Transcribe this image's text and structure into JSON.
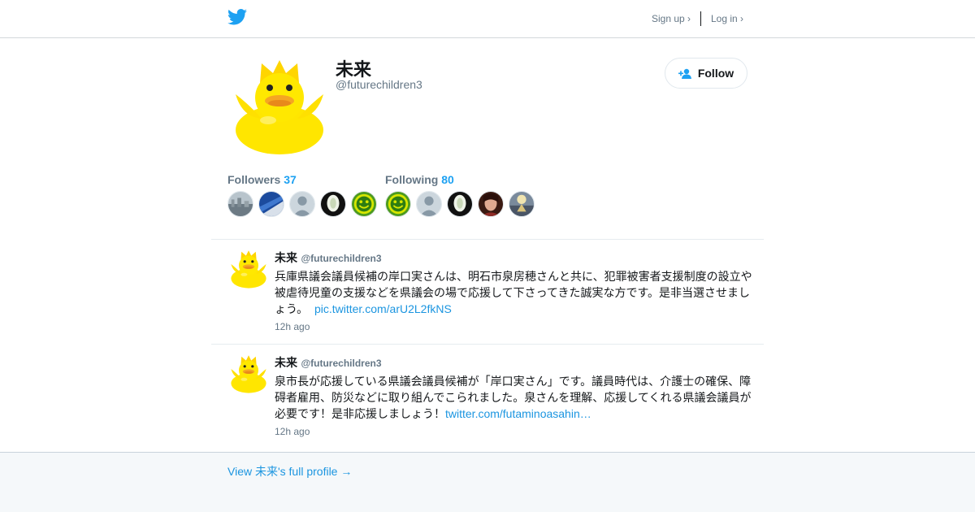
{
  "nav": {
    "signup": "Sign up ›",
    "login": "Log in ›"
  },
  "profile": {
    "name": "未来",
    "handle": "@futurechildren3",
    "follow_label": "Follow"
  },
  "followers": {
    "label": "Followers",
    "count": "37",
    "avatars": [
      "city-photo",
      "blue-sky-photo",
      "default-avatar",
      "flower-photo",
      "green-smiley"
    ]
  },
  "following": {
    "label": "Following",
    "count": "80",
    "avatars": [
      "green-smiley",
      "default-avatar",
      "flower-photo",
      "portrait-photo",
      "landscape-photo"
    ]
  },
  "tweets": [
    {
      "name": "未来",
      "handle": "@futurechildren3",
      "text": "兵庫県議会議員候補の岸口実さんは、明石市泉房穂さんと共に、犯罪被害者支援制度の設立や被虐待児童の支援などを県議会の場で応援して下さってきた誠実な方です。是非当選させましょう。",
      "link": "pic.twitter.com/arU2L2fkNS",
      "time": "12h ago"
    },
    {
      "name": "未来",
      "handle": "@futurechildren3",
      "text": "泉市長が応援している県議会議員候補が「岸口実さん」です。議員時代は、介護士の確保、障碍者雇用、防災などに取り組んでこられました。泉さんを理解、応援してくれる県議会議員が必要です！是非応援しましょう！",
      "link": "twitter.com/futaminoasahin…",
      "time": "12h ago"
    }
  ],
  "footer": {
    "full_profile": "View 未来's full profile →"
  },
  "colors": {
    "brand": "#1da1f2",
    "link": "#1b95e0",
    "muted": "#657786"
  }
}
